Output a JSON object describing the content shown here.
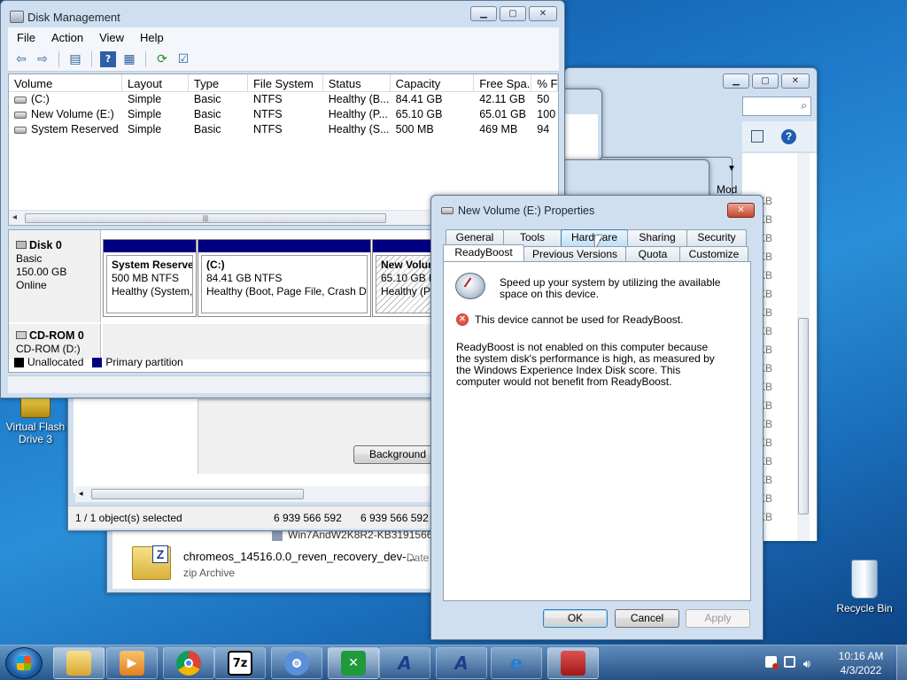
{
  "disk_mgmt": {
    "title": "Disk Management",
    "menu": [
      "File",
      "Action",
      "View",
      "Help"
    ],
    "columns": [
      "Volume",
      "Layout",
      "Type",
      "File System",
      "Status",
      "Capacity",
      "Free Spa...",
      "% F"
    ],
    "volumes": [
      {
        "volume": "(C:)",
        "layout": "Simple",
        "type": "Basic",
        "fs": "NTFS",
        "status": "Healthy (B...",
        "capacity": "84.41 GB",
        "free": "42.11 GB",
        "pct": "50"
      },
      {
        "volume": "New Volume (E:)",
        "layout": "Simple",
        "type": "Basic",
        "fs": "NTFS",
        "status": "Healthy (P...",
        "capacity": "65.10 GB",
        "free": "65.01 GB",
        "pct": "100"
      },
      {
        "volume": "System Reserved",
        "layout": "Simple",
        "type": "Basic",
        "fs": "NTFS",
        "status": "Healthy (S...",
        "capacity": "500 MB",
        "free": "469 MB",
        "pct": "94"
      }
    ],
    "disk0": {
      "name": "Disk 0",
      "kind": "Basic",
      "size": "150.00 GB",
      "state": "Online"
    },
    "partitions": [
      {
        "name": "System Reserve",
        "size": "500 MB NTFS",
        "status": "Healthy (System,"
      },
      {
        "name": "(C:)",
        "size": "84.41 GB NTFS",
        "status": "Healthy (Boot, Page File, Crash Du"
      },
      {
        "name": "New Volum",
        "size": "65.10 GB NTFS",
        "status": "Healthy (Pri"
      }
    ],
    "cdrom": {
      "name": "CD-ROM 0",
      "drive": "CD-ROM (D:)"
    },
    "legend": {
      "unallocated": "Unallocated",
      "primary": "Primary partition"
    }
  },
  "explorer": {
    "background_button": "Background",
    "status_selected": "1 / 1 object(s) selected",
    "status_size1": "6 939 566 592",
    "status_size2": "6 939 566 592",
    "file_partial": "Win7AndW2K8R2-KB3191566-",
    "zip_name": "chromeos_14516.0.0_reven_recovery_dev-...",
    "zip_date_label": "Date",
    "zip_type": "zip Archive",
    "list_header_partial": "Mod",
    "size_units": [
      "KB",
      "KB",
      "KB",
      "KB",
      "KB",
      "KB",
      "KB",
      "KB",
      "KB",
      "KB",
      "KB",
      "KB",
      "KB",
      "KB",
      "KB",
      "KB",
      "KB",
      "KB"
    ]
  },
  "dialog": {
    "title": "New Volume (E:) Properties",
    "tabs_row1": [
      "General",
      "Tools",
      "Hardware",
      "Sharing",
      "Security"
    ],
    "tabs_row2": [
      "ReadyBoost",
      "Previous Versions",
      "Quota",
      "Customize"
    ],
    "intro": "Speed up your system by utilizing the available space on this device.",
    "error": "This device cannot be used for ReadyBoost.",
    "explanation": "ReadyBoost is not enabled on this computer because the system disk's performance is high, as measured by the Windows Experience Index Disk score. This computer would not benefit from ReadyBoost.",
    "ok": "OK",
    "cancel": "Cancel",
    "apply": "Apply"
  },
  "desktop": {
    "icon1": "Virtual Flash Drive 3",
    "icon2": "Recycle Bin"
  },
  "taskbar": {
    "time": "10:16 AM",
    "date": "4/3/2022",
    "apps": [
      "explorer-icon",
      "media-player-icon",
      "chrome-icon",
      "7zip-icon",
      "chromium-icon",
      "excel-icon",
      "app-a-icon",
      "app-a2-icon",
      "ie-icon",
      "toolbox-icon"
    ]
  }
}
